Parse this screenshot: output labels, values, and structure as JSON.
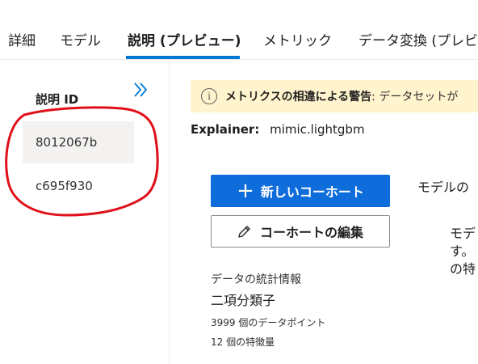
{
  "tabs": [
    {
      "label": "詳細"
    },
    {
      "label": "モデル"
    },
    {
      "label": "説明 (プレビュー)"
    },
    {
      "label": "メトリック"
    },
    {
      "label": "データ変換 (プレビ"
    }
  ],
  "active_tab": "説明 (プレビュー)",
  "left_panel": {
    "title": "説明 ID",
    "items": [
      {
        "label": "8012067b"
      },
      {
        "label": "c695f930"
      }
    ]
  },
  "warning": {
    "icon": "info-icon",
    "bold": "メトリクスの相違による警告",
    "text": ": データセットが"
  },
  "explainer": {
    "label": "Explainer:",
    "value": "mimic.lightgbm"
  },
  "buttons": {
    "new_cohort": "新しいコーホート",
    "edit_cohort": "コーホートの編集"
  },
  "right": {
    "label": "モデルの",
    "desc_line1": "モデ",
    "desc_line2": "す。",
    "desc_line3": "の特"
  },
  "stats": {
    "title": "データの統計情報",
    "type": "二項分類子",
    "points": "3999 個のデータポイント",
    "features": "12 個の特徴量"
  },
  "colors": {
    "accent": "#0078d4",
    "primary_button": "#0f6cdb",
    "warning_bg": "#fff4ce",
    "annotation": "#e0101a"
  }
}
